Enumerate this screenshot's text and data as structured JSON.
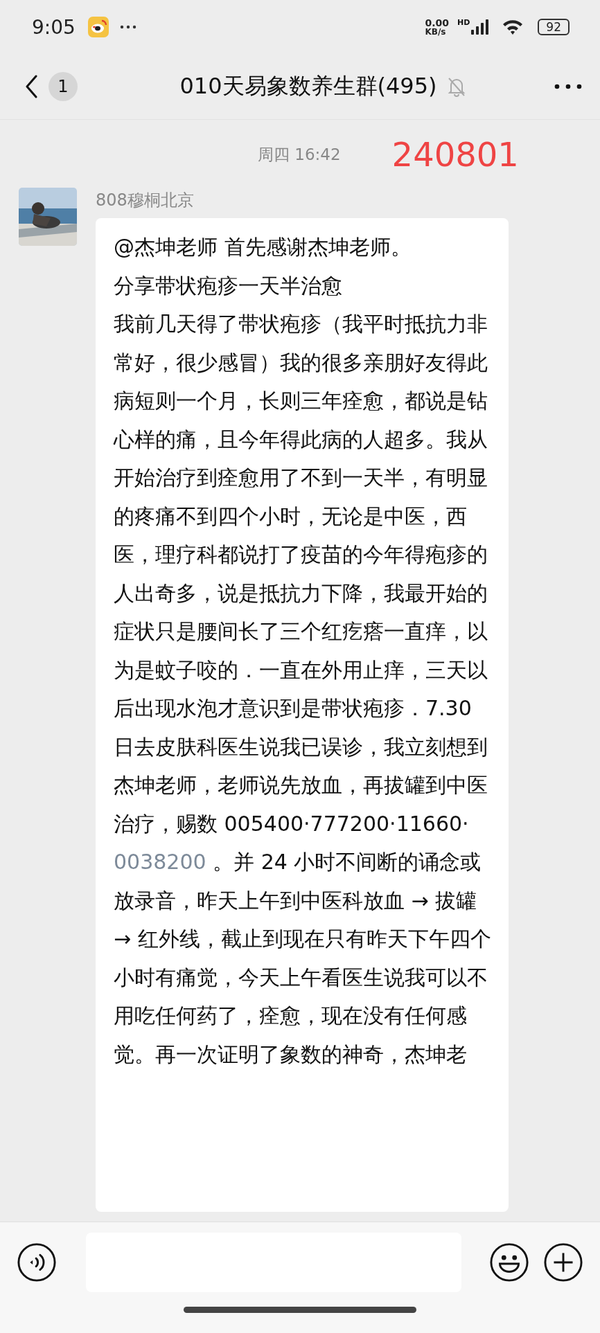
{
  "status_bar": {
    "time": "9:05",
    "net_speed": "0.00",
    "net_unit": "KB/s",
    "network_type": "HD",
    "battery": "92"
  },
  "header": {
    "unread": "1",
    "title": "010天易象数养生群(495)",
    "muted": true
  },
  "timestamp": "周四 16:42",
  "annotation": "240801",
  "message": {
    "sender": "808穆桐北京",
    "paragraphs": [
      {
        "segments": [
          {
            "text": "@杰坤老师  首先感谢杰坤老师。",
            "kind": "text"
          }
        ]
      },
      {
        "segments": [
          {
            "text": "分享带状疱疹一天半治愈",
            "kind": "text"
          }
        ]
      },
      {
        "segments": [
          {
            "text": "我前几天得了带状疱疹（我平时抵抗力非常好，很少感冒）我的很多亲朋好友得此病短则一个月，长则三年痊愈，都说是钻心样的痛，且今年得此病的人超多。我从开始治疗到痊愈用了不到一天半，有明显的疼痛不到四个小时，无论是中医，西医，理疗科都说打了疫苗的今年得疱疹的人出奇多，说是抵抗力下降，我最开始的症状只是腰间长了三个红疙瘩一直痒，以为是蚊子咬的．一直在外用止痒，三天以后出现水泡才意识到是带状疱疹．7.30 日去皮肤科医生说我已误诊，我立刻想到杰坤老师，老师说先放血，再拔罐到中医治疗，赐数 005400·777200·11660·",
            "kind": "text"
          },
          {
            "text": "0038200",
            "kind": "link"
          },
          {
            "text": " 。并 24 小时不间断的诵念或放录音，昨天上午到中医科放血 → 拔罐 → 红外线，截止到现在只有昨天下午四个小时有痛觉，今天上午看医生说我可以不用吃任何药了，痊愈，现在没有任何感觉。再一次证明了象数的神奇，杰坤老",
            "kind": "text"
          }
        ]
      }
    ]
  }
}
